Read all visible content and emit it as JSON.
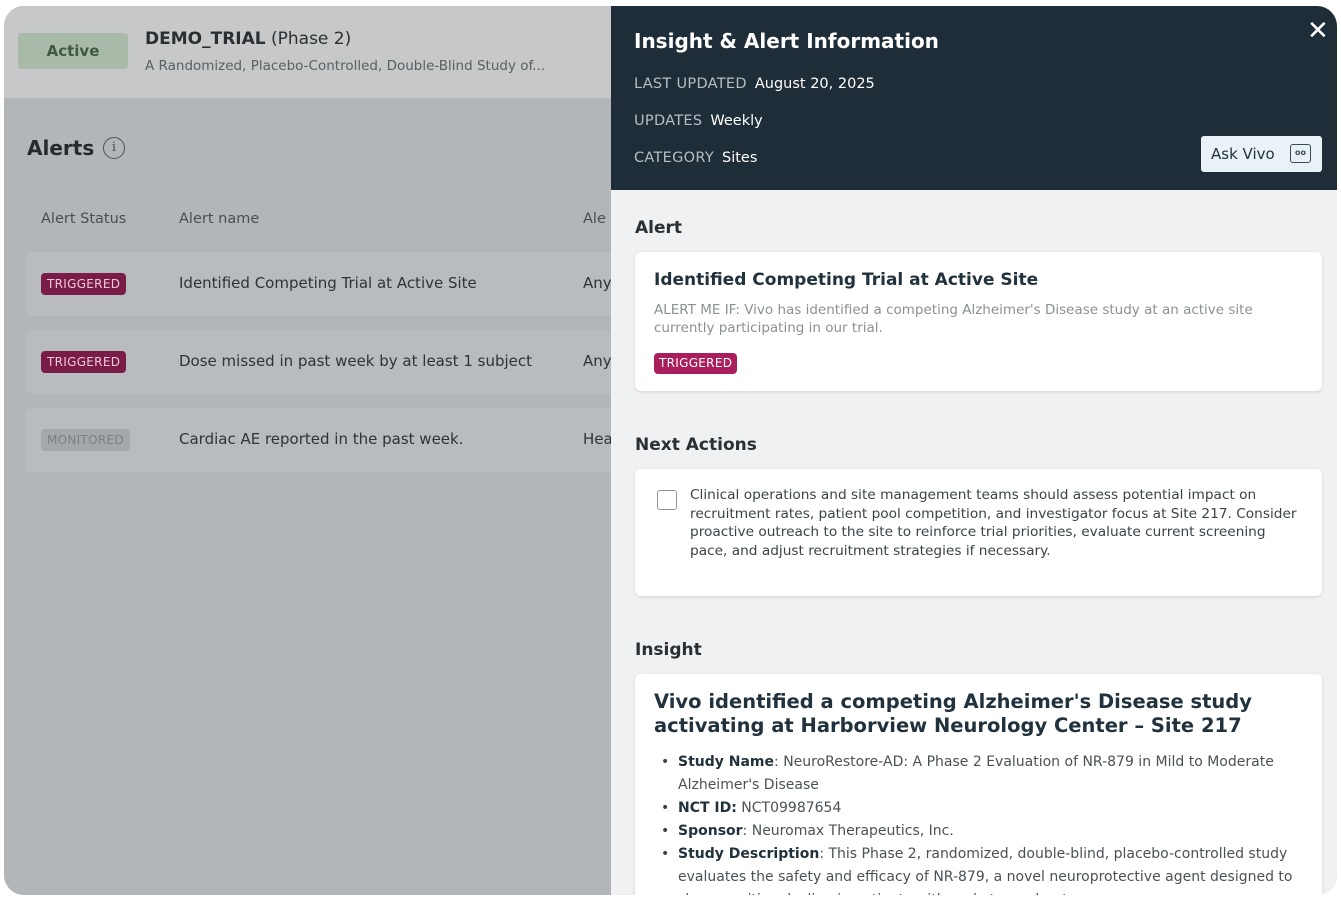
{
  "trial": {
    "status": "Active",
    "name": "DEMO_TRIAL",
    "phase": "(Phase 2)",
    "subtitle": "A Randomized, Placebo-Controlled, Double-Blind Study of..."
  },
  "alerts_page": {
    "title": "Alerts",
    "columns": [
      "Alert Status",
      "Alert name",
      "Ale"
    ],
    "rows": [
      {
        "status": "TRIGGERED",
        "name": "Identified Competing Trial at Active Site",
        "extra": "Any"
      },
      {
        "status": "TRIGGERED",
        "name": "Dose missed in past week by at least 1 subject",
        "extra": "Any"
      },
      {
        "status": "MONITORED",
        "name": "Cardiac AE reported in the past week.",
        "extra": "Hea"
      }
    ]
  },
  "panel": {
    "title": "Insight & Alert Information",
    "close_glyph": "✕",
    "meta": {
      "last_updated_label": "LAST UPDATED",
      "last_updated_value": "August 20, 2025",
      "updates_label": "UPDATES",
      "updates_value": "Weekly",
      "category_label": "CATEGORY",
      "category_value": "Sites"
    },
    "ask_button": "Ask Vivo",
    "ask_icon": "chat-bubble-icon",
    "alert_section": {
      "label": "Alert",
      "title": "Identified Competing Trial at Active Site",
      "description": "ALERT ME IF: Vivo has identified a competing Alzheimer's Disease study at an active site currently participating in our trial.",
      "status": "TRIGGERED"
    },
    "next_actions": {
      "label": "Next Actions",
      "items": [
        "Clinical operations and site management teams should assess potential impact on recruitment rates, patient pool competition, and investigator focus at Site 217. Consider proactive outreach to the site to reinforce trial priorities, evaluate current screening pace, and adjust recruitment strategies if necessary."
      ]
    },
    "insight": {
      "label": "Insight",
      "title": "Vivo identified a competing Alzheimer's Disease study activating at Harborview Neurology Center – Site 217",
      "items": [
        {
          "key": "Study Name",
          "sep": ": ",
          "value": "NeuroRestore-AD: A Phase 2 Evaluation of NR-879 in Mild to Moderate Alzheimer's Disease"
        },
        {
          "key": "NCT ID:",
          "sep": " ",
          "value": "NCT09987654"
        },
        {
          "key": "Sponsor",
          "sep": ": ",
          "value": "Neuromax Therapeutics, Inc."
        },
        {
          "key": "Study Description",
          "sep": ": ",
          "value": "This Phase 2, randomized, double-blind, placebo-controlled study evaluates the safety and efficacy of NR-879, a novel neuroprotective agent designed to slow cognitive decline in patients with early to moderate"
        }
      ]
    }
  },
  "colors": {
    "panel_header": "#1e2d38",
    "triggered_badge": "#aa1e5c",
    "triggered_badge_dimmed": "#7a1c48",
    "overlay": "#b2b6b8"
  }
}
